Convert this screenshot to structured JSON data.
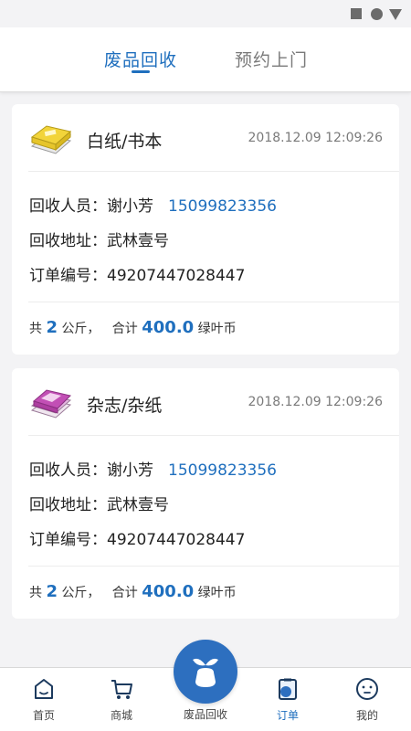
{
  "tabs": [
    {
      "label": "废品回收",
      "active": true
    },
    {
      "label": "预约上门",
      "active": false
    }
  ],
  "colors": {
    "accent": "#1f6fbe",
    "background": "#f3f3f5"
  },
  "orders": [
    {
      "category": "白纸/书本",
      "icon": "paper-stack-icon",
      "time": "2018.12.09 12:09:26",
      "collector_label": "回收人员：",
      "collector_name": "谢小芳",
      "phone": "15099823356",
      "address_label": "回收地址：",
      "address": "武林壹号",
      "order_no_label": "订单编号：",
      "order_no": "49207447028447",
      "summary_prefix": "共",
      "weight": "2",
      "weight_unit": "公斤，",
      "total_label": "合计",
      "total": "400.0",
      "currency": "绿叶币"
    },
    {
      "category": "杂志/杂纸",
      "icon": "magazine-icon",
      "time": "2018.12.09 12:09:26",
      "collector_label": "回收人员：",
      "collector_name": "谢小芳",
      "phone": "15099823356",
      "address_label": "回收地址：",
      "address": "武林壹号",
      "order_no_label": "订单编号：",
      "order_no": "49207447028447",
      "summary_prefix": "共",
      "weight": "2",
      "weight_unit": "公斤，",
      "total_label": "合计",
      "total": "400.0",
      "currency": "绿叶币"
    }
  ],
  "bottom_nav": [
    {
      "label": "首页",
      "icon": "home-icon",
      "active": false
    },
    {
      "label": "商城",
      "icon": "cart-icon",
      "active": false
    },
    {
      "label": "废品回收",
      "icon": "sprout-bag-icon",
      "active": false
    },
    {
      "label": "订单",
      "icon": "order-icon",
      "active": true
    },
    {
      "label": "我的",
      "icon": "face-icon",
      "active": false
    }
  ]
}
